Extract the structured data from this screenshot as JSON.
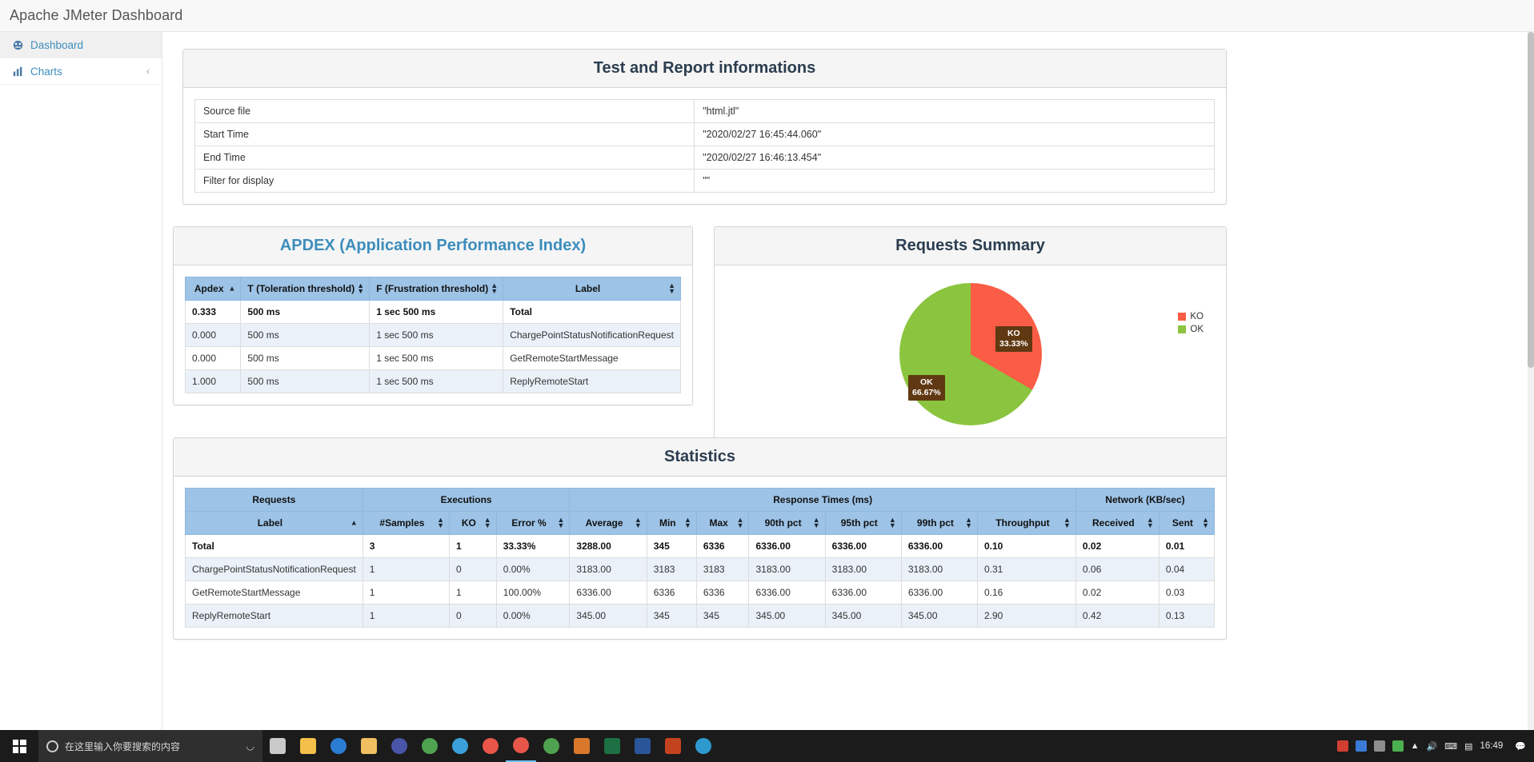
{
  "app": {
    "title": "Apache JMeter Dashboard"
  },
  "sidebar": {
    "items": [
      {
        "label": "Dashboard",
        "icon": "dashboard-icon",
        "active": true,
        "chevron": ""
      },
      {
        "label": "Charts",
        "icon": "bar-chart-icon",
        "active": false,
        "chevron": "‹"
      }
    ]
  },
  "info_panel": {
    "title": "Test and Report informations",
    "rows": [
      {
        "key": "Source file",
        "value": "\"html.jtl\""
      },
      {
        "key": "Start Time",
        "value": "\"2020/02/27 16:45:44.060\""
      },
      {
        "key": "End Time",
        "value": "\"2020/02/27 16:46:13.454\""
      },
      {
        "key": "Filter for display",
        "value": "\"\""
      }
    ]
  },
  "apdex_panel": {
    "title": "APDEX (Application Performance Index)",
    "headers": [
      {
        "label": "Apdex",
        "sort": "asc"
      },
      {
        "label": "T (Toleration threshold)",
        "sort": "both"
      },
      {
        "label": "F (Frustration threshold)",
        "sort": "both"
      },
      {
        "label": "Label",
        "sort": "both"
      }
    ],
    "rows": [
      {
        "apdex": "0.333",
        "t": "500 ms",
        "f": "1 sec 500 ms",
        "label": "Total",
        "total": true
      },
      {
        "apdex": "0.000",
        "t": "500 ms",
        "f": "1 sec 500 ms",
        "label": "ChargePointStatusNotificationRequest",
        "total": false
      },
      {
        "apdex": "0.000",
        "t": "500 ms",
        "f": "1 sec 500 ms",
        "label": "GetRemoteStartMessage",
        "total": false
      },
      {
        "apdex": "1.000",
        "t": "500 ms",
        "f": "1 sec 500 ms",
        "label": "ReplyRemoteStart",
        "total": false
      }
    ]
  },
  "requests_summary": {
    "title": "Requests Summary",
    "chart_data": {
      "type": "pie",
      "title": "Requests Summary",
      "categories": [
        "KO",
        "OK"
      ],
      "values": [
        33.33,
        66.67
      ],
      "labels": [
        "KO 33.33%",
        "OK 66.67%"
      ],
      "colors": [
        "#fa5c45",
        "#8bc53f"
      ],
      "legend": [
        "KO",
        "OK"
      ],
      "legend_position": "right",
      "unit": "%"
    },
    "slice_ko_label": "KO",
    "slice_ko_value": "33.33%",
    "slice_ok_label": "OK",
    "slice_ok_value": "66.67%",
    "legend_ko": "KO",
    "legend_ok": "OK"
  },
  "statistics_panel": {
    "title": "Statistics",
    "group_headers": [
      {
        "label": "Requests",
        "span": 1
      },
      {
        "label": "Executions",
        "span": 3
      },
      {
        "label": "Response Times (ms)",
        "span": 7
      },
      {
        "label": "Network (KB/sec)",
        "span": 2
      }
    ],
    "headers": [
      "Label",
      "#Samples",
      "KO",
      "Error %",
      "Average",
      "Min",
      "Max",
      "90th pct",
      "95th pct",
      "99th pct",
      "Throughput",
      "Received",
      "Sent"
    ],
    "rows": [
      {
        "label": "Total",
        "samples": "3",
        "ko": "1",
        "error": "33.33%",
        "average": "3288.00",
        "min": "345",
        "max": "6336",
        "p90": "6336.00",
        "p95": "6336.00",
        "p99": "6336.00",
        "throughput": "0.10",
        "received": "0.02",
        "sent": "0.01",
        "total": true
      },
      {
        "label": "ChargePointStatusNotificationRequest",
        "samples": "1",
        "ko": "0",
        "error": "0.00%",
        "average": "3183.00",
        "min": "3183",
        "max": "3183",
        "p90": "3183.00",
        "p95": "3183.00",
        "p99": "3183.00",
        "throughput": "0.31",
        "received": "0.06",
        "sent": "0.04",
        "total": false
      },
      {
        "label": "GetRemoteStartMessage",
        "samples": "1",
        "ko": "1",
        "error": "100.00%",
        "average": "6336.00",
        "min": "6336",
        "max": "6336",
        "p90": "6336.00",
        "p95": "6336.00",
        "p99": "6336.00",
        "throughput": "0.16",
        "received": "0.02",
        "sent": "0.03",
        "total": false
      },
      {
        "label": "ReplyRemoteStart",
        "samples": "1",
        "ko": "0",
        "error": "0.00%",
        "average": "345.00",
        "min": "345",
        "max": "345",
        "p90": "345.00",
        "p95": "345.00",
        "p99": "345.00",
        "throughput": "2.90",
        "received": "0.42",
        "sent": "0.13",
        "total": false
      }
    ]
  },
  "taskbar": {
    "search_placeholder": "在这里输入你要搜索的内容",
    "clock_time": "16:49",
    "start_icon": "windows-start-icon",
    "search_icon": "search-circle-icon",
    "task_view_icon": "task-view-icon",
    "pinned": [
      {
        "name": "task-view-icon",
        "color": "#c9c9c9"
      },
      {
        "name": "file-explorer-icon",
        "color": "#f5bf4b"
      },
      {
        "name": "edge-icon",
        "color": "#2b7cd3"
      },
      {
        "name": "folder-icon",
        "color": "#f0c060"
      },
      {
        "name": "teams-icon",
        "color": "#4a55a8"
      },
      {
        "name": "chrome-icon",
        "color": "#4fa24f"
      },
      {
        "name": "ie-icon",
        "color": "#3aa0d9"
      },
      {
        "name": "chrome2-icon",
        "color": "#e8564a"
      },
      {
        "name": "chrome3-icon",
        "color": "#e8564a"
      },
      {
        "name": "jmeter-icon",
        "color": "#d9772b"
      },
      {
        "name": "chrome4-icon",
        "color": "#4fa24f"
      },
      {
        "name": "excel-icon",
        "color": "#1d7044"
      },
      {
        "name": "word-icon",
        "color": "#2a5699"
      },
      {
        "name": "ppt-icon",
        "color": "#c4431f"
      },
      {
        "name": "yy-icon",
        "color": "#2e9ad0"
      }
    ],
    "tray": [
      {
        "name": "tray-red-icon",
        "color": "#d23f31"
      },
      {
        "name": "tray-blue-icon",
        "color": "#3a7bd5"
      },
      {
        "name": "tray-grey-icon",
        "color": "#8d8d8d"
      },
      {
        "name": "tray-green-icon",
        "color": "#4caf50"
      },
      {
        "name": "tray-network-icon",
        "color": "#cccccc"
      },
      {
        "name": "tray-volume-icon",
        "color": "#cccccc"
      },
      {
        "name": "tray-input-icon",
        "color": "#cccccc"
      },
      {
        "name": "tray-battery-icon",
        "color": "#cccccc"
      }
    ]
  }
}
